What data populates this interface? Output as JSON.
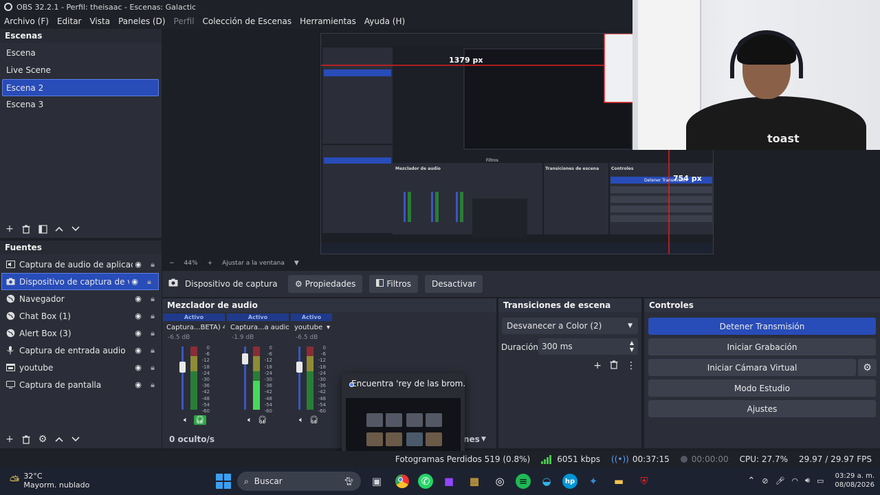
{
  "window": {
    "title": "OBS 32.2.1 - Perfil: theisaac - Escenas: Galactic"
  },
  "menu": {
    "items": [
      "Archivo (F)",
      "Editar",
      "Vista",
      "Paneles (D)",
      "Perfil",
      "Colección de Escenas",
      "Herramientas",
      "Ayuda (H)"
    ]
  },
  "scenes": {
    "header": "Escenas",
    "items": [
      "Escena",
      "Live Scene",
      "Escena 2",
      "Escena 3"
    ],
    "selected": "Escena 2"
  },
  "sources": {
    "header": "Fuentes",
    "items": [
      {
        "name": "Captura de audio de aplicación",
        "icon": "app-audio-icon"
      },
      {
        "name": "Dispositivo de captura de video",
        "icon": "camera-icon"
      },
      {
        "name": "Navegador",
        "icon": "globe-icon"
      },
      {
        "name": "Chat Box (1)",
        "icon": "globe-icon"
      },
      {
        "name": "Alert Box (3)",
        "icon": "globe-icon"
      },
      {
        "name": "Captura de entrada audio",
        "icon": "microphone-icon"
      },
      {
        "name": "youtube",
        "icon": "window-icon"
      },
      {
        "name": "Captura de pantalla",
        "icon": "monitor-icon"
      }
    ]
  },
  "preview": {
    "measure_h": "1379 px",
    "measure_v": "754 px",
    "zoom": "44%",
    "fit_label": "Ajustar a la ventana",
    "embedded": {
      "filters": "Filtros",
      "mixer": "Mezclador de audio",
      "transitions": "Transiciones de escena",
      "controls": "Controles",
      "stop_stream": "Detener Transmisión"
    },
    "webcam_shirt_text": "toast"
  },
  "source_bar": {
    "selected_name": "Dispositivo de captura de video",
    "properties": "Propiedades",
    "filters": "Filtros",
    "deactivate": "Desactivar"
  },
  "mixer": {
    "header": "Mezclador de audio",
    "channels": [
      {
        "active": "Activo",
        "name": "Captura...BETA) 4",
        "db": "-6.5 dB"
      },
      {
        "active": "Activo",
        "name": "Captura...a audio",
        "db": "-1.9 dB"
      },
      {
        "active": "Activo",
        "name": "youtube",
        "db": "-6.5 dB"
      }
    ],
    "scale": [
      "0",
      "-6",
      "-12",
      "-18",
      "-24",
      "-30",
      "-36",
      "-42",
      "-48",
      "-54",
      "-60"
    ],
    "footer": "0 oculto/s",
    "footer_hidden_suffix": "nes"
  },
  "transitions": {
    "header": "Transiciones de escena",
    "selected": "Desvanecer a Color (2)",
    "duration_label": "Duración",
    "duration_value": "300 ms"
  },
  "controls": {
    "header": "Controles",
    "stop_stream": "Detener Transmisión",
    "start_recording": "Iniciar Grabación",
    "start_virtual_cam": "Iniciar Cámara Virtual",
    "studio_mode": "Modo Estudio",
    "settings": "Ajustes"
  },
  "popup": {
    "title": "Encuentra 'rey de las brom..."
  },
  "status": {
    "dropped": "Fotogramas Perdidos 519 (0.8%)",
    "bitrate": "6051 kbps",
    "stream_time": "00:37:15",
    "rec_time": "00:00:00",
    "cpu": "CPU: 27.7%",
    "fps": "29.97 / 29.97 FPS"
  },
  "taskbar": {
    "temp": "32°C",
    "weather": "Mayorm. nublado",
    "search": "Buscar",
    "time": "03:29 a. m.",
    "date": "08/08/2026"
  },
  "colors": {
    "accent": "#284cb8",
    "dock_bg": "#2b2e38",
    "window_bg": "#1d1f26",
    "meter_green": "#48d85a",
    "marker_red": "#e01f1f"
  }
}
